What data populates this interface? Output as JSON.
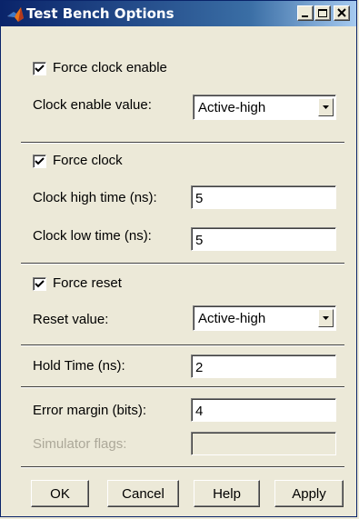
{
  "window": {
    "title": "Test Bench Options",
    "icon": "matlab-logo-icon",
    "controls": [
      "minimize-icon",
      "maximize-icon",
      "close-icon"
    ]
  },
  "clock_enable": {
    "force_label": "Force clock enable",
    "force_checked": true,
    "value_label": "Clock enable value:",
    "value": "Active-high"
  },
  "clock": {
    "force_label": "Force clock",
    "force_checked": true,
    "high_label": "Clock high time (ns):",
    "high_value": "5",
    "low_label": "Clock low time (ns):",
    "low_value": "5"
  },
  "reset": {
    "force_label": "Force reset",
    "force_checked": true,
    "value_label": "Reset value:",
    "value": "Active-high"
  },
  "hold": {
    "label": "Hold Time (ns):",
    "value": "2"
  },
  "error_margin": {
    "label": "Error margin (bits):",
    "value": "4"
  },
  "simulator": {
    "label": "Simulator flags:",
    "value": "",
    "disabled": true
  },
  "buttons": {
    "ok": "OK",
    "cancel": "Cancel",
    "help": "Help",
    "apply": "Apply"
  },
  "colors": {
    "dialog_bg": "#ece9d8",
    "titlebar_start": "#0a246a",
    "titlebar_end": "#a6caf0",
    "disabled_text": "#aca899"
  }
}
